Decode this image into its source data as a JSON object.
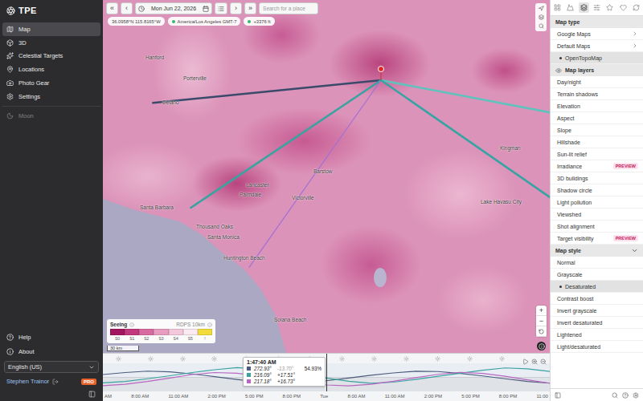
{
  "app": {
    "logo": "TPE"
  },
  "sidebar": {
    "items": [
      {
        "label": "Map",
        "selected": true,
        "disabled": false
      },
      {
        "label": "3D",
        "selected": false,
        "disabled": false
      },
      {
        "label": "Celestial Targets",
        "selected": false,
        "disabled": false
      },
      {
        "label": "Locations",
        "selected": false,
        "disabled": false
      },
      {
        "label": "Photo Gear",
        "selected": false,
        "disabled": false
      },
      {
        "label": "Settings",
        "selected": false,
        "disabled": false
      },
      {
        "label": "Moon",
        "selected": false,
        "disabled": true
      }
    ],
    "footer": [
      {
        "label": "Help"
      },
      {
        "label": "About"
      }
    ],
    "language": "English (US)",
    "user": {
      "name": "Stephen Trainor",
      "badge": "PRO"
    }
  },
  "toolbar": {
    "first": "«",
    "prev": "‹",
    "next": "›",
    "last": "»",
    "date": "Mon Jun 22, 2026",
    "search_placeholder": "Search for a place"
  },
  "chips": [
    {
      "label": "36.0958°N 115.8165°W",
      "dot": false
    },
    {
      "label": "America/Los Angeles GMT-7",
      "dot": true
    },
    {
      "label": "+3376 ft",
      "dot": true
    }
  ],
  "map": {
    "labels": [
      "Hanford",
      "Porterville",
      "Delano",
      "Lancaster",
      "Palmdale",
      "Santa Barbara",
      "Thousand Oaks",
      "Santa Monica",
      "Huntington Beach",
      "Victorville",
      "Barstow",
      "Kingman",
      "Lake Havasu City",
      "Solana Beach"
    ],
    "lines": [
      {
        "azimuth": 264.3,
        "kind": "target",
        "color": "#3b4a6b"
      },
      {
        "azimuth": 236.1,
        "kind": "target",
        "color": "#3aa3a0"
      },
      {
        "azimuth": 215.1,
        "kind": "target",
        "color": "#a070d6"
      },
      {
        "azimuth": 100.8,
        "kind": "ray",
        "color": "#5fc2bd"
      },
      {
        "azimuth": 124.8,
        "kind": "ray",
        "color": "#38a3a3"
      }
    ],
    "legend": {
      "title": "Seeing",
      "source": "RDPS 10km",
      "cells": [
        {
          "label": "S0",
          "color": "#a3165f"
        },
        {
          "label": "S1",
          "color": "#c13a7e"
        },
        {
          "label": "S2",
          "color": "#d86ba0"
        },
        {
          "label": "S3",
          "color": "#e89cc0"
        },
        {
          "label": "S4",
          "color": "#f3c8db"
        },
        {
          "label": "S5",
          "color": "#fbeaf2"
        },
        {
          "label": "!",
          "color": "#f2dc3c"
        }
      ]
    },
    "scale": "30 km",
    "zoom_in": "+",
    "zoom_out": "−"
  },
  "timeline": {
    "cursor_time": "1:47:40 AM",
    "readouts": [
      {
        "azimuth": "272.93°",
        "altitude": "-13.70°",
        "altitude_dimmed": true,
        "illumination": "54.93%",
        "color": "#4c5c7c"
      },
      {
        "azimuth": "216.09°",
        "altitude": "+17.51°",
        "altitude_dimmed": false,
        "color": "#3aa3a0"
      },
      {
        "azimuth": "217.18°",
        "altitude": "+16.73°",
        "altitude_dimmed": false,
        "color": "#b866c0"
      }
    ],
    "series": [
      {
        "color": "#4c5c7c",
        "values": [
          20,
          35,
          45,
          40,
          25,
          5,
          -15,
          -35,
          -45,
          -40,
          -25,
          -5,
          15,
          32,
          44,
          42,
          28,
          10,
          -10,
          -30,
          -42
        ]
      },
      {
        "color": "#3aa3a0",
        "values": [
          -40,
          -30,
          -10,
          12,
          35,
          55,
          70,
          60,
          40,
          18,
          -5,
          -28,
          -42,
          -35,
          -15,
          8,
          30,
          52,
          68,
          62,
          42
        ]
      },
      {
        "color": "#b866c0",
        "values": [
          -60,
          -50,
          -30,
          -5,
          20,
          35,
          30,
          10,
          -15,
          -40,
          -55,
          -62,
          -50,
          -28,
          -2,
          22,
          36,
          28,
          8,
          -18,
          -42
        ]
      }
    ],
    "ticks": [
      "AM",
      "8:00 AM",
      "11:00 AM",
      "2:00 PM",
      "5:00 PM",
      "8:00 PM",
      "Tue",
      "8:00 AM",
      "11:00 AM",
      "2:00 PM",
      "5:00 PM",
      "8:00 PM",
      "11:00"
    ]
  },
  "panel": {
    "tabs": [
      {
        "selected": false
      },
      {
        "selected": false
      },
      {
        "selected": true
      },
      {
        "selected": false
      },
      {
        "selected": false
      },
      {
        "selected": false
      },
      {
        "selected": false
      }
    ],
    "sections": [
      {
        "title": "Map type",
        "items": [
          {
            "label": "Google Maps",
            "kind": "link",
            "selected": false
          },
          {
            "label": "Default Maps",
            "kind": "link",
            "selected": false
          },
          {
            "label": "OpenTopoMap",
            "kind": "option",
            "selected": true
          }
        ]
      },
      {
        "title": "Map layers",
        "items": [
          {
            "label": "Day/night",
            "kind": "layer",
            "selected": false
          },
          {
            "label": "Terrain shadows",
            "kind": "layer",
            "selected": false
          },
          {
            "label": "Elevation",
            "kind": "layer",
            "selected": false
          },
          {
            "label": "Aspect",
            "kind": "layer",
            "selected": false
          },
          {
            "label": "Slope",
            "kind": "layer",
            "selected": false
          },
          {
            "label": "Hillshade",
            "kind": "layer",
            "selected": false
          },
          {
            "label": "Sun-lit relief",
            "kind": "layer",
            "selected": false
          },
          {
            "label": "Irradiance",
            "kind": "layer",
            "selected": false,
            "badge": "PREVIEW"
          },
          {
            "label": "3D buildings",
            "kind": "layer",
            "selected": false
          },
          {
            "label": "Shadow circle",
            "kind": "layer",
            "selected": false
          },
          {
            "label": "Light pollution",
            "kind": "layer",
            "selected": false
          },
          {
            "label": "Viewshed",
            "kind": "layer",
            "selected": false
          },
          {
            "label": "Shot alignment",
            "kind": "layer",
            "selected": false
          },
          {
            "label": "Target visibility",
            "kind": "layer",
            "selected": false,
            "badge": "PREVIEW"
          }
        ]
      },
      {
        "title": "Map style",
        "expanded": true,
        "items": [
          {
            "label": "Normal",
            "kind": "option",
            "selected": false
          },
          {
            "label": "Grayscale",
            "kind": "option",
            "selected": false
          },
          {
            "label": "Desaturated",
            "kind": "option",
            "selected": true
          },
          {
            "label": "Contrast boost",
            "kind": "option",
            "selected": false
          },
          {
            "label": "Invert grayscale",
            "kind": "option",
            "selected": false
          },
          {
            "label": "Invert desaturated",
            "kind": "option",
            "selected": false
          },
          {
            "label": "Lightened",
            "kind": "option",
            "selected": false
          },
          {
            "label": "Light/desaturated",
            "kind": "option",
            "selected": false
          }
        ]
      }
    ]
  }
}
